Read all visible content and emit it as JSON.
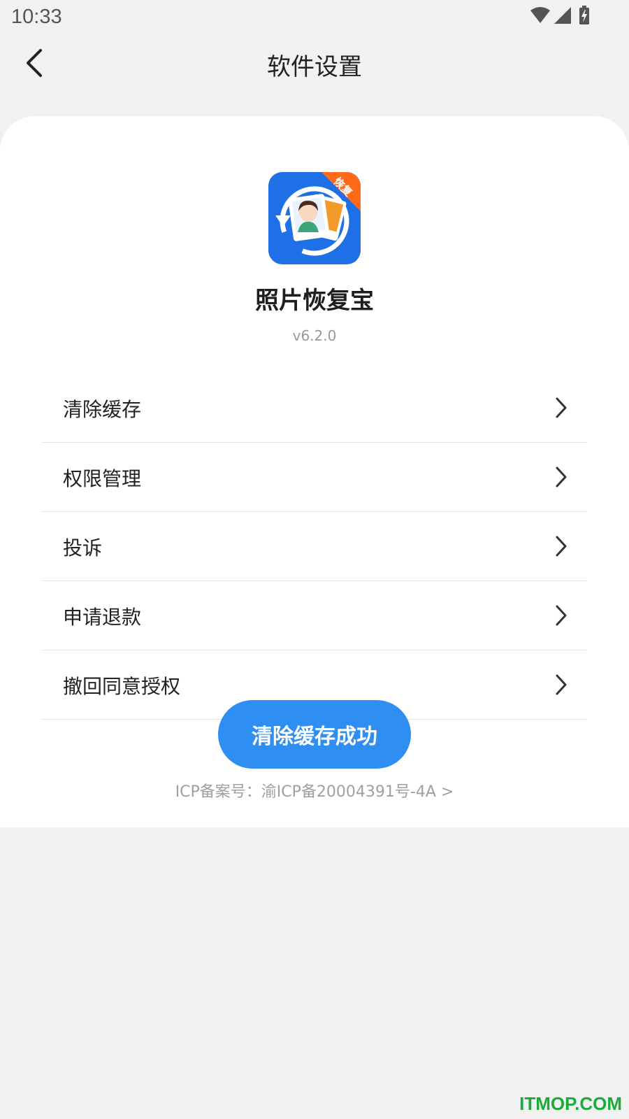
{
  "status_bar": {
    "time": "10:33",
    "icons": [
      "wifi-icon",
      "cellular-signal-icon",
      "battery-charging-icon"
    ]
  },
  "nav": {
    "back_icon": "chevron-left-icon",
    "title": "软件设置"
  },
  "app": {
    "badge_text": "恢复",
    "name": "照片恢复宝",
    "version": "v6.2.0"
  },
  "menu": [
    {
      "label": "清除缓存",
      "icon": "chevron-right-icon"
    },
    {
      "label": "权限管理",
      "icon": "chevron-right-icon"
    },
    {
      "label": "投诉",
      "icon": "chevron-right-icon"
    },
    {
      "label": "申请退款",
      "icon": "chevron-right-icon"
    },
    {
      "label": "撤回同意授权",
      "icon": "chevron-right-icon"
    }
  ],
  "toast": {
    "text": "清除缓存成功"
  },
  "footer": {
    "icp": "ICP备案号：渝ICP备20004391号-4A >"
  },
  "watermark": "ITMOP.COM",
  "colors": {
    "background": "#f1f1f1",
    "card": "#ffffff",
    "accent": "#2e8ef2",
    "app_icon_blue": "#1f6fe6",
    "badge_orange": "#ff6a1a",
    "watermark": "#1aab3a"
  }
}
